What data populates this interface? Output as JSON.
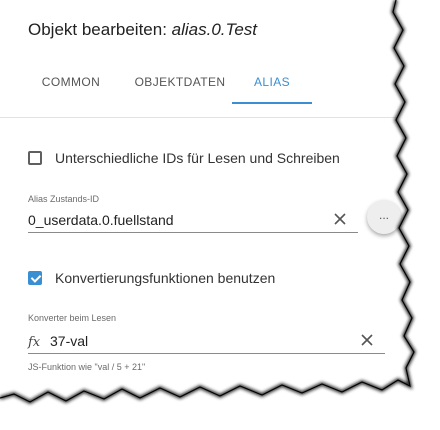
{
  "dialog": {
    "title_prefix": "Objekt bearbeiten: ",
    "object_id": "alias.0.Test"
  },
  "tabs": [
    {
      "label": "COMMON",
      "active": false
    },
    {
      "label": "OBJEKTDATEN",
      "active": false
    },
    {
      "label": "ALIAS",
      "active": true
    }
  ],
  "different_ids": {
    "label": "Unterschiedliche IDs für Lesen und Schreiben",
    "checked": false
  },
  "alias_state_id": {
    "label": "Alias Zustands-ID",
    "value": "0_userdata.0.fuellstand",
    "more_label": "..."
  },
  "use_conversion": {
    "label": "Konvertierungsfunktionen benutzen",
    "checked": true
  },
  "read_converter": {
    "label": "Konverter beim Lesen",
    "fx_symbol": "fx",
    "value": "37-val",
    "helper": "JS-Funktion wie \"val / 5 + 21\""
  },
  "colors": {
    "accent": "#3a8fd3",
    "text": "#222222",
    "muted": "#6b6b6b"
  },
  "icons": {
    "clear": "close-icon",
    "fx": "function-icon",
    "checkbox_checked": "checkbox-checked-icon",
    "checkbox_unchecked": "checkbox-unchecked-icon"
  }
}
